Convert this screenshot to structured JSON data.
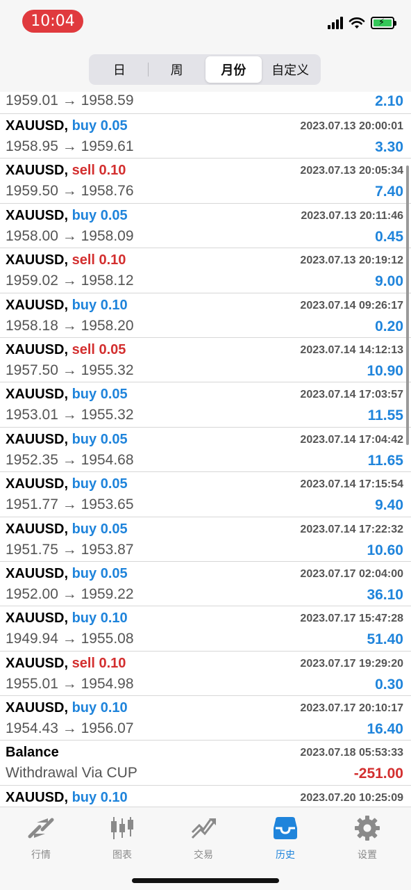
{
  "status_bar": {
    "time": "10:04"
  },
  "periods": {
    "day": "日",
    "week": "周",
    "month": "月份",
    "custom": "自定义",
    "selected": "月份"
  },
  "trades": [
    {
      "symbol": "",
      "side": "",
      "lot": "",
      "datetime": "",
      "open": "1959.01",
      "close": "1958.59",
      "profit": "2.10",
      "partial": true
    },
    {
      "symbol": "XAUUSD,",
      "side": "buy",
      "lot": "0.05",
      "datetime": "2023.07.13 20:00:01",
      "open": "1958.95",
      "close": "1959.61",
      "profit": "3.30"
    },
    {
      "symbol": "XAUUSD,",
      "side": "sell",
      "lot": "0.10",
      "datetime": "2023.07.13 20:05:34",
      "open": "1959.50",
      "close": "1958.76",
      "profit": "7.40"
    },
    {
      "symbol": "XAUUSD,",
      "side": "buy",
      "lot": "0.05",
      "datetime": "2023.07.13 20:11:46",
      "open": "1958.00",
      "close": "1958.09",
      "profit": "0.45"
    },
    {
      "symbol": "XAUUSD,",
      "side": "sell",
      "lot": "0.10",
      "datetime": "2023.07.13 20:19:12",
      "open": "1959.02",
      "close": "1958.12",
      "profit": "9.00"
    },
    {
      "symbol": "XAUUSD,",
      "side": "buy",
      "lot": "0.10",
      "datetime": "2023.07.14 09:26:17",
      "open": "1958.18",
      "close": "1958.20",
      "profit": "0.20"
    },
    {
      "symbol": "XAUUSD,",
      "side": "sell",
      "lot": "0.05",
      "datetime": "2023.07.14 14:12:13",
      "open": "1957.50",
      "close": "1955.32",
      "profit": "10.90"
    },
    {
      "symbol": "XAUUSD,",
      "side": "buy",
      "lot": "0.05",
      "datetime": "2023.07.14 17:03:57",
      "open": "1953.01",
      "close": "1955.32",
      "profit": "11.55"
    },
    {
      "symbol": "XAUUSD,",
      "side": "buy",
      "lot": "0.05",
      "datetime": "2023.07.14 17:04:42",
      "open": "1952.35",
      "close": "1954.68",
      "profit": "11.65"
    },
    {
      "symbol": "XAUUSD,",
      "side": "buy",
      "lot": "0.05",
      "datetime": "2023.07.14 17:15:54",
      "open": "1951.77",
      "close": "1953.65",
      "profit": "9.40"
    },
    {
      "symbol": "XAUUSD,",
      "side": "buy",
      "lot": "0.05",
      "datetime": "2023.07.14 17:22:32",
      "open": "1951.75",
      "close": "1953.87",
      "profit": "10.60"
    },
    {
      "symbol": "XAUUSD,",
      "side": "buy",
      "lot": "0.05",
      "datetime": "2023.07.17 02:04:00",
      "open": "1952.00",
      "close": "1959.22",
      "profit": "36.10"
    },
    {
      "symbol": "XAUUSD,",
      "side": "buy",
      "lot": "0.10",
      "datetime": "2023.07.17 15:47:28",
      "open": "1949.94",
      "close": "1955.08",
      "profit": "51.40"
    },
    {
      "symbol": "XAUUSD,",
      "side": "sell",
      "lot": "0.10",
      "datetime": "2023.07.17 19:29:20",
      "open": "1955.01",
      "close": "1954.98",
      "profit": "0.30"
    },
    {
      "symbol": "XAUUSD,",
      "side": "buy",
      "lot": "0.10",
      "datetime": "2023.07.17 20:10:17",
      "open": "1954.43",
      "close": "1956.07",
      "profit": "16.40"
    }
  ],
  "balance": {
    "title": "Balance",
    "datetime": "2023.07.18 05:53:33",
    "description": "Withdrawal Via CUP",
    "amount": "-251.00"
  },
  "last_trade": {
    "symbol": "XAUUSD,",
    "side": "buy",
    "lot": "0.10",
    "datetime": "2023.07.20 10:25:09"
  },
  "arrow": "→",
  "colors": {
    "buy": "#1f84db",
    "sell": "#d32f2f",
    "accent": "#1f84db",
    "time_pill": "#e03a3e"
  },
  "tabs": [
    {
      "label": "行情",
      "icon": "quotes-icon"
    },
    {
      "label": "图表",
      "icon": "chart-icon"
    },
    {
      "label": "交易",
      "icon": "trade-icon"
    },
    {
      "label": "历史",
      "icon": "history-icon",
      "active": true
    },
    {
      "label": "设置",
      "icon": "gear-icon"
    }
  ]
}
